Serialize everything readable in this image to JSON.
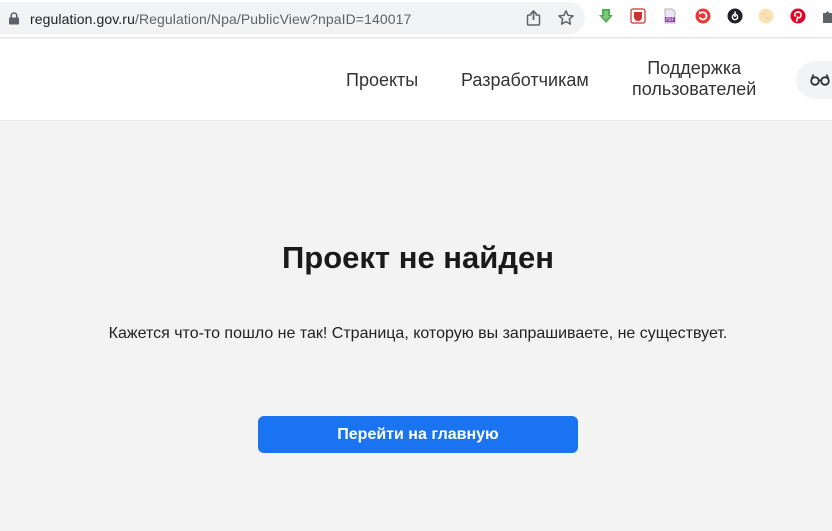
{
  "browser": {
    "url_host": "regulation.gov.ru",
    "url_path": "/Regulation/Npa/PublicView?npaID=140017",
    "icons": {
      "lock": "lock-icon",
      "share": "share-icon",
      "star": "bookmark-star-icon"
    },
    "extensions": [
      {
        "icon": "download-arrow-icon",
        "color": "#4caf50"
      },
      {
        "icon": "shield-icon",
        "color": "#d32f2f"
      },
      {
        "icon": "pdf-icon",
        "color": "#8e44ad"
      },
      {
        "icon": "refresh-circle-icon",
        "color": "#e53935"
      },
      {
        "icon": "dark-circle-icon",
        "color": "#202124"
      },
      {
        "icon": "cookie-icon",
        "color": "#f5deb3"
      },
      {
        "icon": "pinterest-icon",
        "color": "#e60023"
      },
      {
        "icon": "puzzle-icon",
        "color": "#5f6368"
      }
    ]
  },
  "header": {
    "nav": {
      "projects": "Проекты",
      "developers": "Разработчикам",
      "support_line1": "Поддержка",
      "support_line2": "пользователей"
    },
    "vision_icon": "glasses-icon"
  },
  "main": {
    "title": "Проект не найден",
    "message": "Кажется что-то пошло не так! Страница, которую вы запрашиваете, не существует.",
    "home_button": "Перейти на главную",
    "accent_color": "#1a73f0"
  }
}
